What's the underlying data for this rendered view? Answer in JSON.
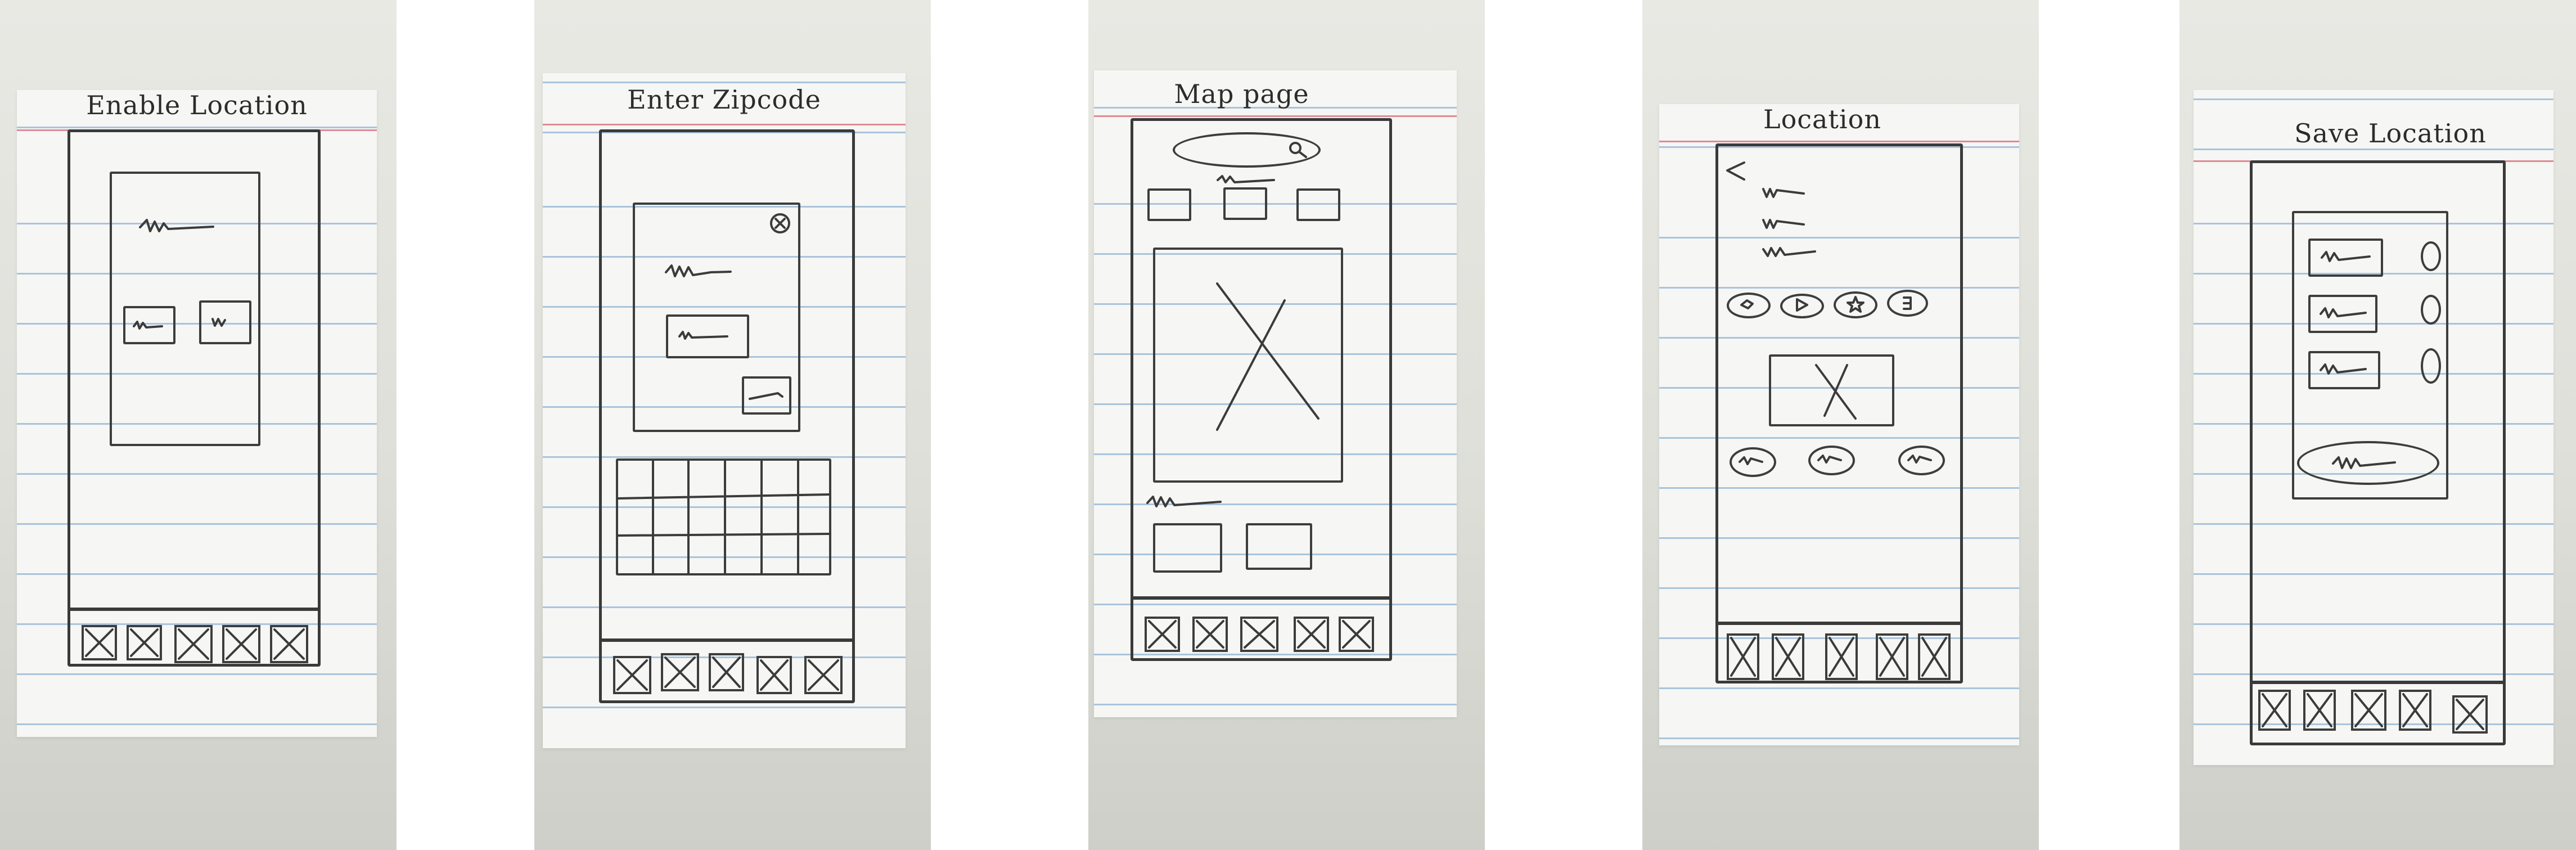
{
  "sketches": [
    {
      "id": "enable-location",
      "title": "Enable Location"
    },
    {
      "id": "enter-zipcode",
      "title": "Enter Zipcode"
    },
    {
      "id": "map-page",
      "title": "Map page"
    },
    {
      "id": "location",
      "title": "Location"
    },
    {
      "id": "save-location",
      "title": "Save Location"
    }
  ],
  "colors": {
    "paper": "#f6f6f4",
    "rule_line": "#a9c4dc",
    "margin_line": "#e08a95",
    "pencil": "#3b3b3b",
    "background": "#dedfd9"
  },
  "icons": {
    "nav_item": "x-placeholder-icon",
    "close": "close-circle-icon",
    "search": "search-icon",
    "back": "back-arrow-icon"
  }
}
